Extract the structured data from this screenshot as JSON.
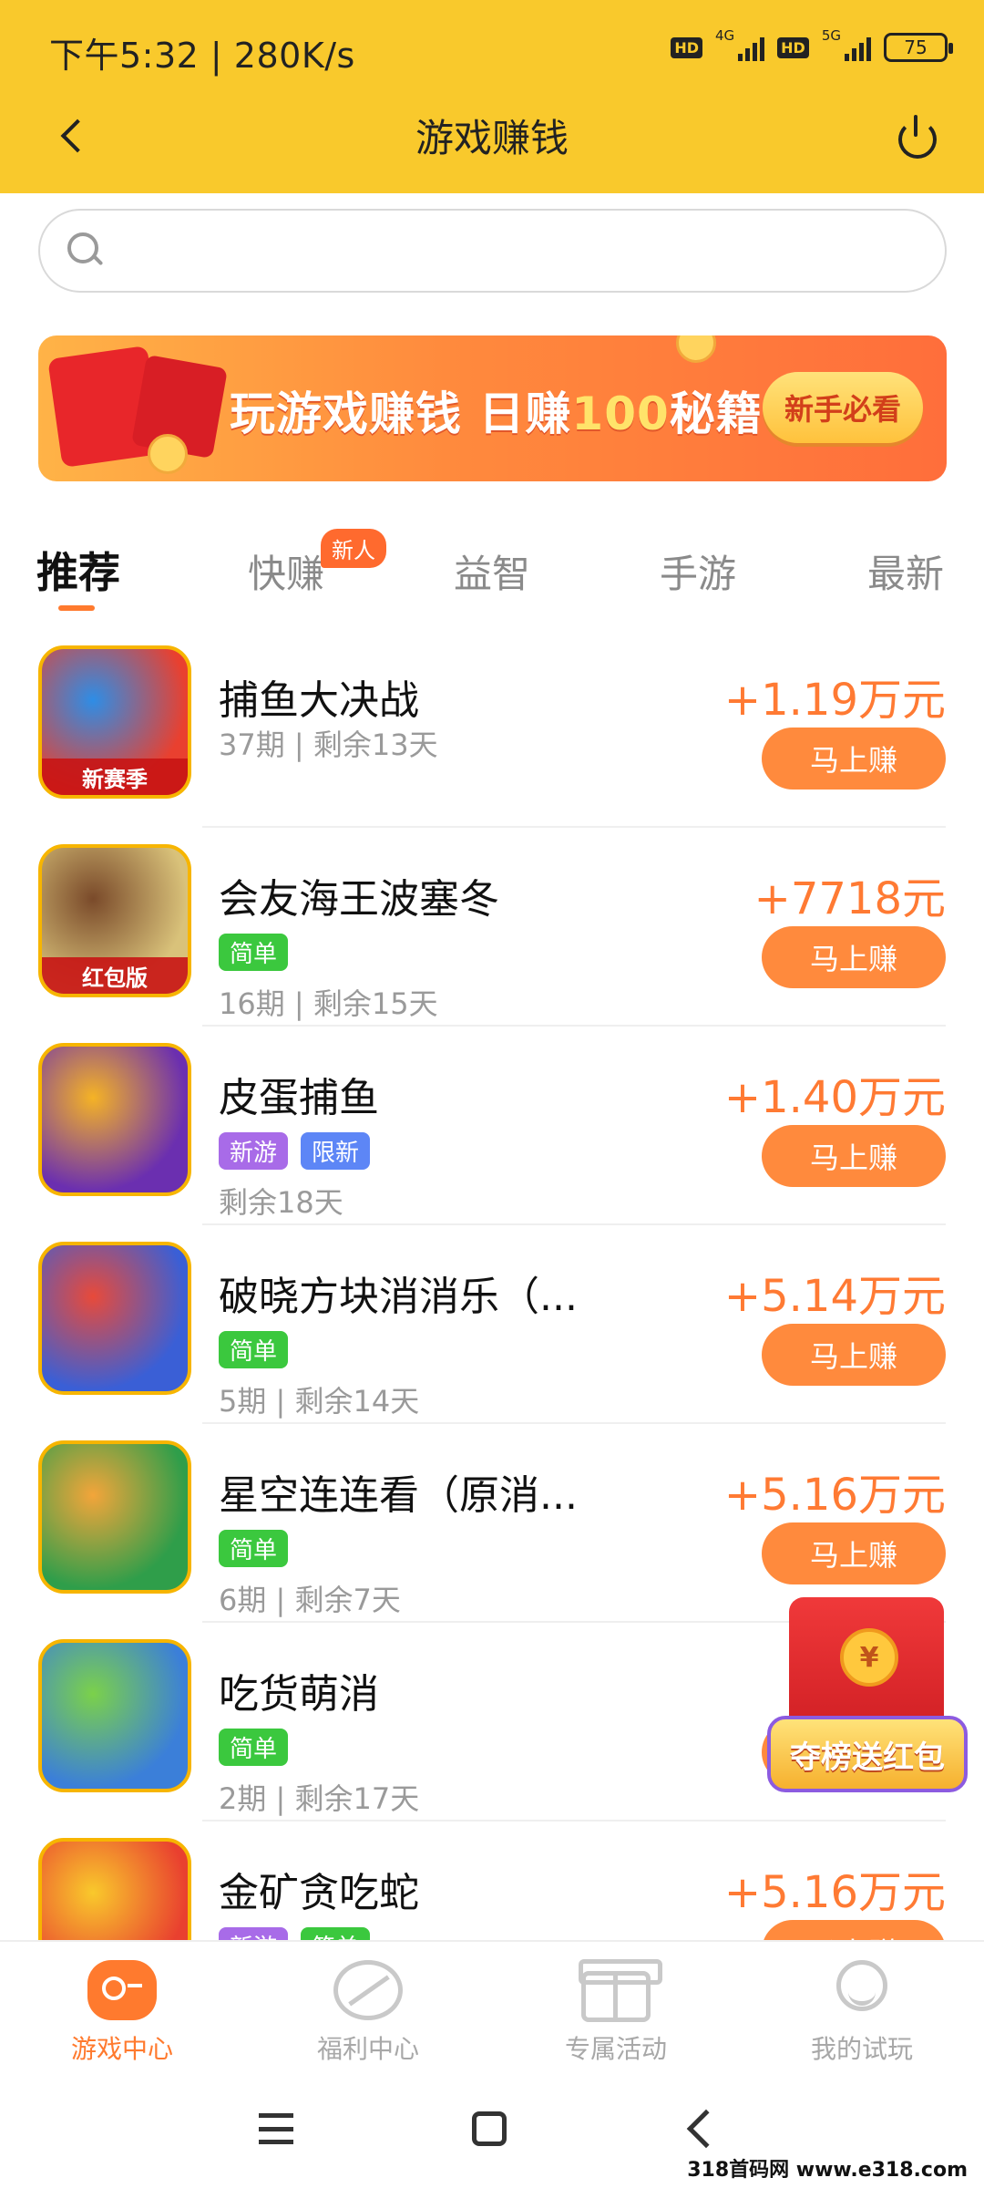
{
  "status_bar": {
    "time": "下午5:32 | 280K/s",
    "hd1": "HD",
    "net1": "4G",
    "hd2": "HD",
    "net2": "5G",
    "battery": "75"
  },
  "header": {
    "title": "游戏赚钱"
  },
  "search": {
    "placeholder": ""
  },
  "banner": {
    "text_main": "玩游戏赚钱 日赚",
    "text_highlight": "100",
    "text_tail": "秘籍",
    "button": "新手必看"
  },
  "tabs": [
    {
      "label": "推荐"
    },
    {
      "label": "快赚",
      "badge": "新人"
    },
    {
      "label": "益智"
    },
    {
      "label": "手游"
    },
    {
      "label": "最新"
    }
  ],
  "games": [
    {
      "name": "捕鱼大决战",
      "tags": [],
      "meta": "37期 | 剩余13天",
      "amount": "+1.19万元",
      "button": "马上赚",
      "corner": "新赛季",
      "colors": [
        "#E9402F",
        "#2E8DE6"
      ]
    },
    {
      "name": "会友海王波塞冬",
      "tags": [
        "简单"
      ],
      "meta": "16期 | 剩余15天",
      "amount": "+7718元",
      "button": "马上赚",
      "corner": "红包版",
      "colors": [
        "#D9C27A",
        "#7A4A2A"
      ]
    },
    {
      "name": "皮蛋捕鱼",
      "tags": [
        "新游",
        "限新"
      ],
      "meta": "剩余18天",
      "amount": "+1.40万元",
      "button": "马上赚",
      "corner": "",
      "colors": [
        "#6B2FB0",
        "#F5B325"
      ]
    },
    {
      "name": "破晓方块消消乐（...",
      "tags": [
        "简单"
      ],
      "meta": "5期 | 剩余14天",
      "amount": "+5.14万元",
      "button": "马上赚",
      "corner": "",
      "colors": [
        "#3A5FD6",
        "#E84A3A"
      ]
    },
    {
      "name": "星空连连看（原消...",
      "tags": [
        "简单"
      ],
      "meta": "6期 | 剩余7天",
      "amount": "+5.16万元",
      "button": "马上赚",
      "corner": "",
      "colors": [
        "#2F9E4A",
        "#F3A53A"
      ]
    },
    {
      "name": "吃货萌消",
      "tags": [
        "简单"
      ],
      "meta": "2期 | 剩余17天",
      "amount": "+",
      "button": "马上赚",
      "corner": "",
      "colors": [
        "#3B7FD9",
        "#7BD14A"
      ]
    },
    {
      "name": "金矿贪吃蛇",
      "tags": [
        "新游",
        "简单"
      ],
      "meta": "",
      "amount": "+5.16万元",
      "button": "马上赚",
      "corner": "",
      "colors": [
        "#E9402F",
        "#F9C92C"
      ]
    }
  ],
  "floating": {
    "coin": "¥",
    "label": "夺榜送红包"
  },
  "bottom_nav": [
    {
      "label": "游戏中心",
      "active": true
    },
    {
      "label": "福利中心",
      "active": false
    },
    {
      "label": "专属活动",
      "active": false
    },
    {
      "label": "我的试玩",
      "active": false
    }
  ],
  "watermark": "318首码网 www.e318.com",
  "colors": {
    "header": "#F9C92C",
    "accent": "#FF7A2E",
    "tag_green": "#3BC83E",
    "tag_purple": "#A86BE8",
    "tag_blue": "#5D86F6"
  }
}
